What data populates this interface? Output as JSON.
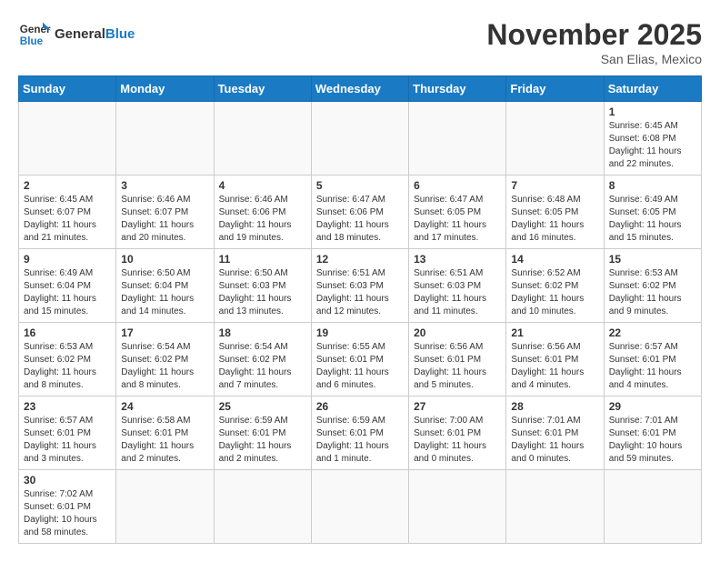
{
  "header": {
    "logo_general": "General",
    "logo_blue": "Blue",
    "month_title": "November 2025",
    "location": "San Elias, Mexico"
  },
  "days_of_week": [
    "Sunday",
    "Monday",
    "Tuesday",
    "Wednesday",
    "Thursday",
    "Friday",
    "Saturday"
  ],
  "weeks": [
    [
      {
        "day": "",
        "info": ""
      },
      {
        "day": "",
        "info": ""
      },
      {
        "day": "",
        "info": ""
      },
      {
        "day": "",
        "info": ""
      },
      {
        "day": "",
        "info": ""
      },
      {
        "day": "",
        "info": ""
      },
      {
        "day": "1",
        "info": "Sunrise: 6:45 AM\nSunset: 6:08 PM\nDaylight: 11 hours and 22 minutes."
      }
    ],
    [
      {
        "day": "2",
        "info": "Sunrise: 6:45 AM\nSunset: 6:07 PM\nDaylight: 11 hours and 21 minutes."
      },
      {
        "day": "3",
        "info": "Sunrise: 6:46 AM\nSunset: 6:07 PM\nDaylight: 11 hours and 20 minutes."
      },
      {
        "day": "4",
        "info": "Sunrise: 6:46 AM\nSunset: 6:06 PM\nDaylight: 11 hours and 19 minutes."
      },
      {
        "day": "5",
        "info": "Sunrise: 6:47 AM\nSunset: 6:06 PM\nDaylight: 11 hours and 18 minutes."
      },
      {
        "day": "6",
        "info": "Sunrise: 6:47 AM\nSunset: 6:05 PM\nDaylight: 11 hours and 17 minutes."
      },
      {
        "day": "7",
        "info": "Sunrise: 6:48 AM\nSunset: 6:05 PM\nDaylight: 11 hours and 16 minutes."
      },
      {
        "day": "8",
        "info": "Sunrise: 6:49 AM\nSunset: 6:05 PM\nDaylight: 11 hours and 15 minutes."
      }
    ],
    [
      {
        "day": "9",
        "info": "Sunrise: 6:49 AM\nSunset: 6:04 PM\nDaylight: 11 hours and 15 minutes."
      },
      {
        "day": "10",
        "info": "Sunrise: 6:50 AM\nSunset: 6:04 PM\nDaylight: 11 hours and 14 minutes."
      },
      {
        "day": "11",
        "info": "Sunrise: 6:50 AM\nSunset: 6:03 PM\nDaylight: 11 hours and 13 minutes."
      },
      {
        "day": "12",
        "info": "Sunrise: 6:51 AM\nSunset: 6:03 PM\nDaylight: 11 hours and 12 minutes."
      },
      {
        "day": "13",
        "info": "Sunrise: 6:51 AM\nSunset: 6:03 PM\nDaylight: 11 hours and 11 minutes."
      },
      {
        "day": "14",
        "info": "Sunrise: 6:52 AM\nSunset: 6:02 PM\nDaylight: 11 hours and 10 minutes."
      },
      {
        "day": "15",
        "info": "Sunrise: 6:53 AM\nSunset: 6:02 PM\nDaylight: 11 hours and 9 minutes."
      }
    ],
    [
      {
        "day": "16",
        "info": "Sunrise: 6:53 AM\nSunset: 6:02 PM\nDaylight: 11 hours and 8 minutes."
      },
      {
        "day": "17",
        "info": "Sunrise: 6:54 AM\nSunset: 6:02 PM\nDaylight: 11 hours and 8 minutes."
      },
      {
        "day": "18",
        "info": "Sunrise: 6:54 AM\nSunset: 6:02 PM\nDaylight: 11 hours and 7 minutes."
      },
      {
        "day": "19",
        "info": "Sunrise: 6:55 AM\nSunset: 6:01 PM\nDaylight: 11 hours and 6 minutes."
      },
      {
        "day": "20",
        "info": "Sunrise: 6:56 AM\nSunset: 6:01 PM\nDaylight: 11 hours and 5 minutes."
      },
      {
        "day": "21",
        "info": "Sunrise: 6:56 AM\nSunset: 6:01 PM\nDaylight: 11 hours and 4 minutes."
      },
      {
        "day": "22",
        "info": "Sunrise: 6:57 AM\nSunset: 6:01 PM\nDaylight: 11 hours and 4 minutes."
      }
    ],
    [
      {
        "day": "23",
        "info": "Sunrise: 6:57 AM\nSunset: 6:01 PM\nDaylight: 11 hours and 3 minutes."
      },
      {
        "day": "24",
        "info": "Sunrise: 6:58 AM\nSunset: 6:01 PM\nDaylight: 11 hours and 2 minutes."
      },
      {
        "day": "25",
        "info": "Sunrise: 6:59 AM\nSunset: 6:01 PM\nDaylight: 11 hours and 2 minutes."
      },
      {
        "day": "26",
        "info": "Sunrise: 6:59 AM\nSunset: 6:01 PM\nDaylight: 11 hours and 1 minute."
      },
      {
        "day": "27",
        "info": "Sunrise: 7:00 AM\nSunset: 6:01 PM\nDaylight: 11 hours and 0 minutes."
      },
      {
        "day": "28",
        "info": "Sunrise: 7:01 AM\nSunset: 6:01 PM\nDaylight: 11 hours and 0 minutes."
      },
      {
        "day": "29",
        "info": "Sunrise: 7:01 AM\nSunset: 6:01 PM\nDaylight: 10 hours and 59 minutes."
      }
    ],
    [
      {
        "day": "30",
        "info": "Sunrise: 7:02 AM\nSunset: 6:01 PM\nDaylight: 10 hours and 58 minutes."
      },
      {
        "day": "",
        "info": ""
      },
      {
        "day": "",
        "info": ""
      },
      {
        "day": "",
        "info": ""
      },
      {
        "day": "",
        "info": ""
      },
      {
        "day": "",
        "info": ""
      },
      {
        "day": "",
        "info": ""
      }
    ]
  ]
}
